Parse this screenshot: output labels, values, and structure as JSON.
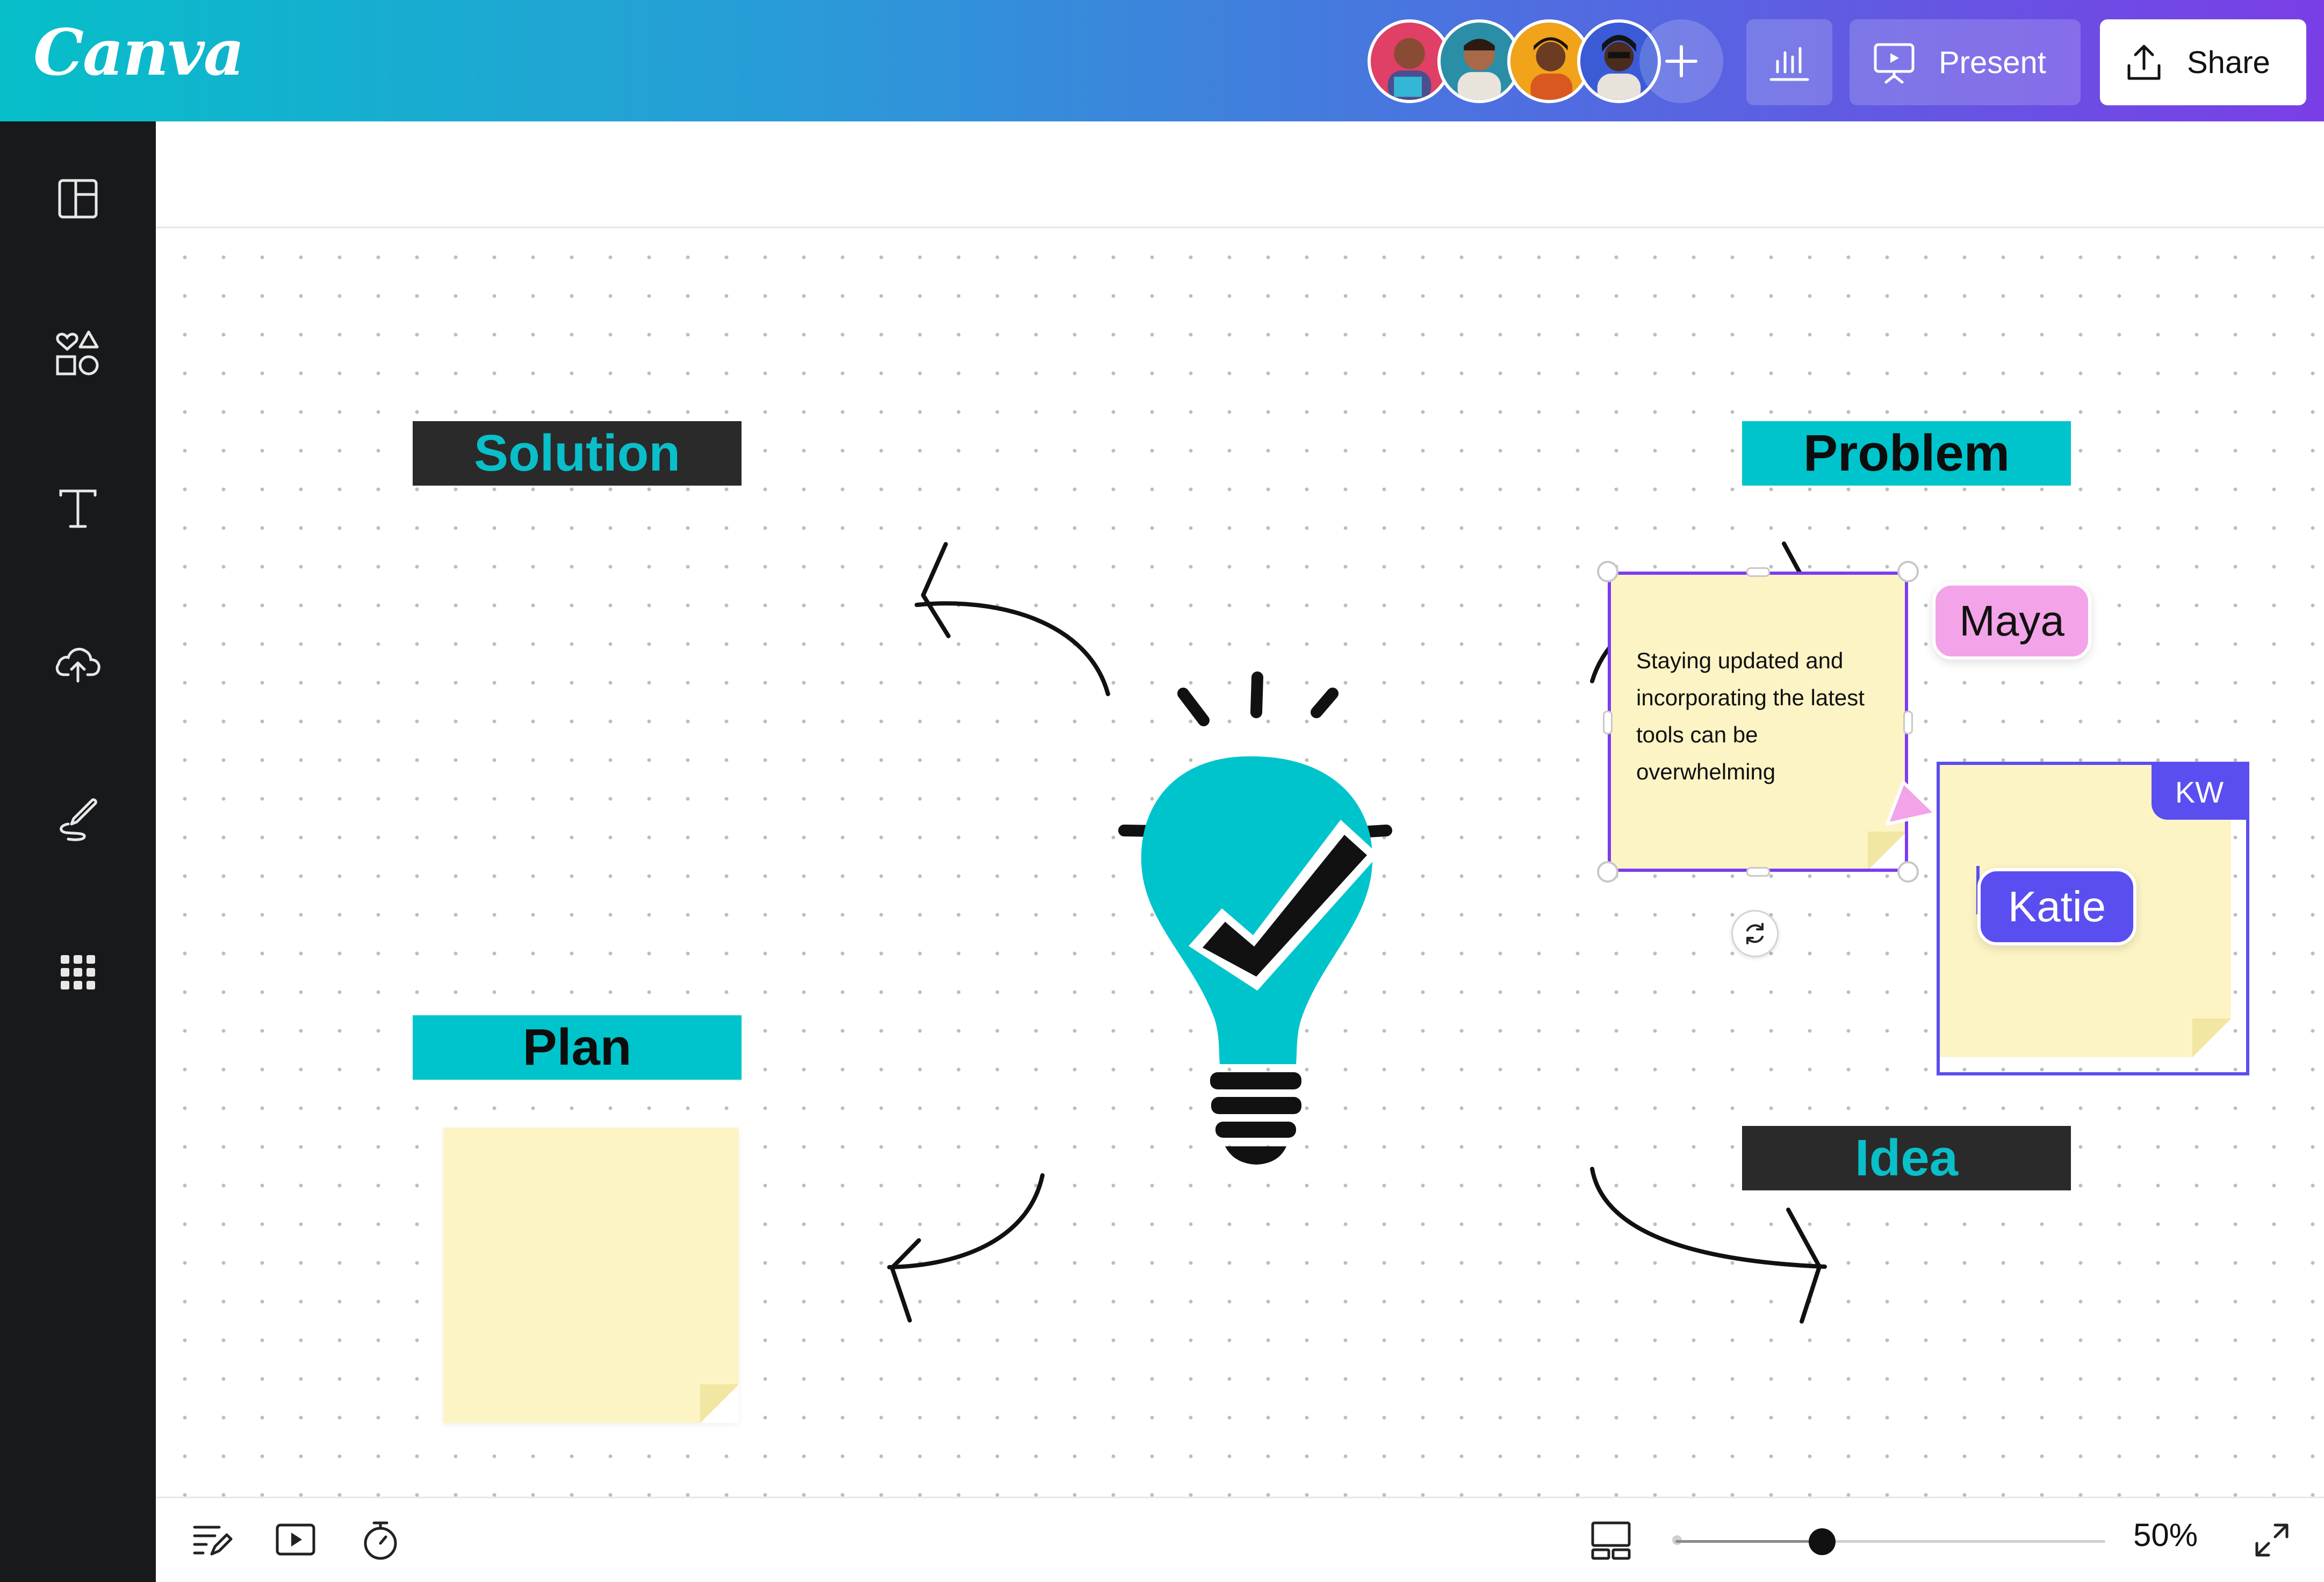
{
  "app": {
    "logo_text": "Canva"
  },
  "header": {
    "collaborators": [
      {
        "name": "collaborator-1",
        "bg": "#e03f66"
      },
      {
        "name": "collaborator-2",
        "bg": "#2a8fa6"
      },
      {
        "name": "collaborator-3",
        "bg": "#f1a31a"
      },
      {
        "name": "collaborator-4",
        "bg": "#3b5bd6"
      }
    ],
    "add_icon": "plus-icon",
    "analytics_icon": "bar-chart-icon",
    "present_label": "Present",
    "present_icon": "presentation-icon",
    "share_label": "Share",
    "share_icon": "upload-share-icon"
  },
  "sidebar": {
    "items": [
      {
        "name": "templates",
        "icon": "layout-icon"
      },
      {
        "name": "elements",
        "icon": "shapes-icon"
      },
      {
        "name": "text",
        "icon": "text-icon"
      },
      {
        "name": "uploads",
        "icon": "cloud-upload-icon"
      },
      {
        "name": "draw",
        "icon": "draw-icon"
      },
      {
        "name": "apps",
        "icon": "apps-grid-icon"
      }
    ]
  },
  "whiteboard": {
    "labels": {
      "solution": "Solution",
      "problem": "Problem",
      "plan": "Plan",
      "idea": "Idea"
    },
    "center_icon": "lightbulb-checkmark-icon",
    "sticky_note_text": "Staying updated and incorporating the latest tools can be overwhelming",
    "cursors": {
      "maya": "Maya",
      "katie": "Katie"
    },
    "kw_initials": "KW",
    "colors": {
      "accent_teal": "#00c4cc",
      "dark_label": "#2a2a2a",
      "sticky_yellow": "#fcf4c5",
      "selection_purple": "#7d3cf0",
      "maya_pink": "#f3a3e8",
      "katie_blue": "#5b4ef0"
    }
  },
  "footer": {
    "notes_icon": "notes-icon",
    "play_icon": "play-icon",
    "timer_icon": "timer-icon",
    "view_icon": "page-view-icon",
    "zoom_level": "50%",
    "zoom_fraction": 0.5,
    "fullscreen_icon": "expand-icon"
  }
}
